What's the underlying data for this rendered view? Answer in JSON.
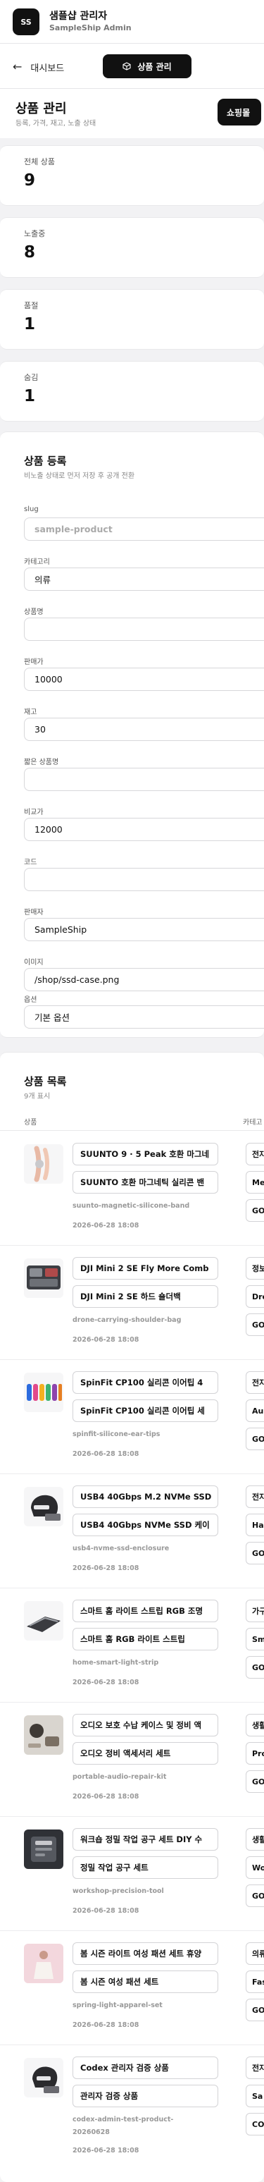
{
  "app": {
    "logo": "SS",
    "title": "샘플샵 관리자",
    "subtitle": "SampleShip Admin"
  },
  "nav": {
    "back_label": "대시보드",
    "active_tab": "상품 관리"
  },
  "page": {
    "title": "상품 관리",
    "description": "등록, 가격, 재고, 노출 상태",
    "shop_button": "쇼핑몰"
  },
  "stats": [
    {
      "label": "전체 상품",
      "value": "9"
    },
    {
      "label": "노출중",
      "value": "8"
    },
    {
      "label": "품절",
      "value": "1"
    },
    {
      "label": "숨김",
      "value": "1"
    }
  ],
  "form": {
    "title": "상품 등록",
    "description": "비노출 상태로 먼저 저장 후 공개 전환",
    "fields": [
      {
        "label": "slug",
        "value": "",
        "placeholder": "sample-product"
      },
      {
        "label": "카테고리",
        "value": "의류",
        "placeholder": ""
      },
      {
        "label": "상품명",
        "value": "",
        "placeholder": ""
      },
      {
        "label": "판매가",
        "value": "10000",
        "placeholder": ""
      },
      {
        "label": "재고",
        "value": "30",
        "placeholder": ""
      },
      {
        "label": "짧은 상품명",
        "value": "",
        "placeholder": ""
      },
      {
        "label": "비교가",
        "value": "12000",
        "placeholder": ""
      },
      {
        "label": "코드",
        "value": "",
        "placeholder": ""
      },
      {
        "label": "판매자",
        "value": "SampleShip",
        "placeholder": ""
      },
      {
        "label": "이미지",
        "value": "/shop/ssd-case.png",
        "placeholder": ""
      },
      {
        "label": "옵션",
        "value": "기본 옵션",
        "placeholder": ""
      }
    ]
  },
  "list": {
    "title": "상품 목록",
    "count": "9개 표시",
    "columns": [
      "상품",
      "카테고"
    ],
    "rows": [
      {
        "name": "SUUNTO 9 · 5 Peak 호환 마그네",
        "short_name": "SUUNTO 호환 마그네틱 실리콘 밴",
        "slug": "suunto-magnetic-silicone-band",
        "date": "2026-06-28 18:08",
        "cat1": "전자",
        "cat2": "Me",
        "cat3": "GO",
        "thumb": "watch-band"
      },
      {
        "name": "DJI Mini 2 SE Fly More Comb",
        "short_name": "DJI Mini 2 SE 하드 숄더백",
        "slug": "drone-carrying-shoulder-bag",
        "date": "2026-06-28 18:08",
        "cat1": "정보",
        "cat2": "Dro",
        "cat3": "GO",
        "thumb": "drone-bag"
      },
      {
        "name": "SpinFit CP100 실리콘 이어팁 4",
        "short_name": "SpinFit CP100 실리콘 이어팁 세",
        "slug": "spinfit-silicone-ear-tips",
        "date": "2026-06-28 18:08",
        "cat1": "전자",
        "cat2": "Au",
        "cat3": "GO",
        "thumb": "ear-tips"
      },
      {
        "name": "USB4 40Gbps M.2 NVMe SSD",
        "short_name": "USB4 40Gbps NVMe SSD 케이",
        "slug": "usb4-nvme-ssd-enclosure",
        "date": "2026-06-28 18:08",
        "cat1": "전자",
        "cat2": "Ha",
        "cat3": "GO",
        "thumb": "ssd-case"
      },
      {
        "name": "스마트 홈 라이트 스트립 RGB 조명",
        "short_name": "스마트 홈 RGB 라이트 스트립",
        "slug": "home-smart-light-strip",
        "date": "2026-06-28 18:08",
        "cat1": "가구",
        "cat2": "Sm",
        "cat3": "GO",
        "thumb": "light-strip"
      },
      {
        "name": "오디오 보호 수납 케이스 및 정비 액",
        "short_name": "오디오 정비 액세서리 세트",
        "slug": "portable-audio-repair-kit",
        "date": "2026-06-28 18:08",
        "cat1": "생활",
        "cat2": "Pro",
        "cat3": "GO",
        "thumb": "audio-kit"
      },
      {
        "name": "워크숍 정밀 작업 공구 세트 DIY 수",
        "short_name": "정밀 작업 공구 세트",
        "slug": "workshop-precision-tool",
        "date": "2026-06-28 18:08",
        "cat1": "생활",
        "cat2": "Wo",
        "cat3": "GO",
        "thumb": "tool-set"
      },
      {
        "name": "봄 시즌 라이트 여성 패션 세트 휴양",
        "short_name": "봄 시즌 여성 패션 세트",
        "slug": "spring-light-apparel-set",
        "date": "2026-06-28 18:08",
        "cat1": "의류",
        "cat2": "Fas",
        "cat3": "GO",
        "thumb": "apparel"
      },
      {
        "name": "Codex 관리자 검증 상품",
        "short_name": "관리자 검증 상품",
        "slug": "codex-admin-test-product-",
        "slug2": "20260628",
        "date": "2026-06-28 18:08",
        "cat1": "전자",
        "cat2": "Sa",
        "cat3": "CO",
        "thumb": "helmet"
      }
    ]
  },
  "colors": {
    "primary": "#111111",
    "background": "#f2f2f4",
    "muted": "#999999"
  }
}
